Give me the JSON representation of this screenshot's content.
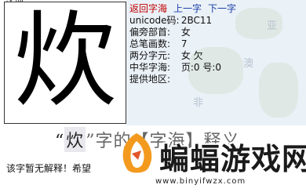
{
  "top_fragment": "汉词",
  "character": "炊",
  "nav": {
    "back": "返回字海",
    "prev": "上一字",
    "next": "下一字"
  },
  "info": [
    {
      "label": "unicode码:",
      "value": "2BC11"
    },
    {
      "label": "偏旁部首:",
      "value": "女"
    },
    {
      "label": "总笔画数:",
      "value": "7"
    },
    {
      "label": "两分字元:",
      "value": "女 欠"
    },
    {
      "label": "中华字海:",
      "value": "页:0 号:0"
    },
    {
      "label": "提供地区:",
      "value": ""
    }
  ],
  "title": {
    "open_quote": "“",
    "char": "炊",
    "rest": "”字的【字海】释义"
  },
  "no_explanation": "该字暂无解释！希望",
  "banner": {
    "brand": "蝙蝠游戏网",
    "url": "www.binyifwzx.com",
    "logo_color": "#f39a1e"
  },
  "map_labels": [
    "亚",
    "澳",
    "非"
  ]
}
